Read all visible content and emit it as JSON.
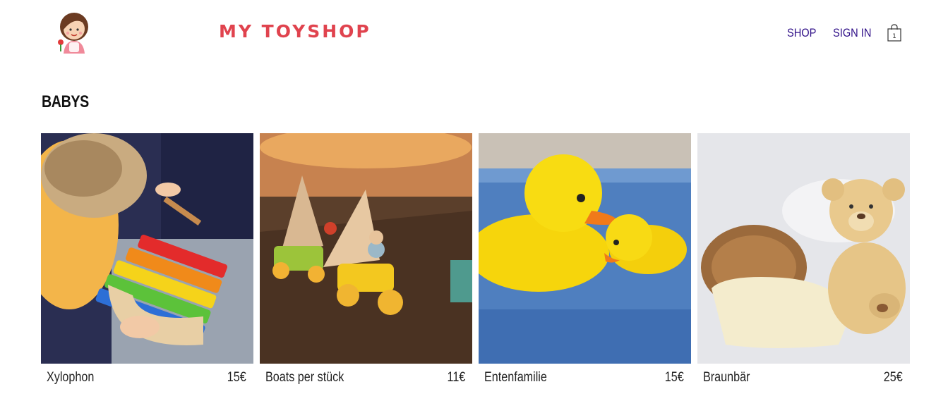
{
  "header": {
    "brand": "MY TOYSHOP",
    "nav": {
      "shop": "SHOP",
      "signin": "SIGN IN"
    },
    "cart_count": "1"
  },
  "section": {
    "title": "BABYS"
  },
  "products": [
    {
      "name": "Xylophon",
      "price": "15€"
    },
    {
      "name": "Boats per stück",
      "price": "11€"
    },
    {
      "name": "Entenfamilie",
      "price": "15€"
    },
    {
      "name": "Braunbär",
      "price": "25€"
    }
  ],
  "colors": {
    "brand": "#e0434e",
    "nav": "#2e0e87"
  }
}
